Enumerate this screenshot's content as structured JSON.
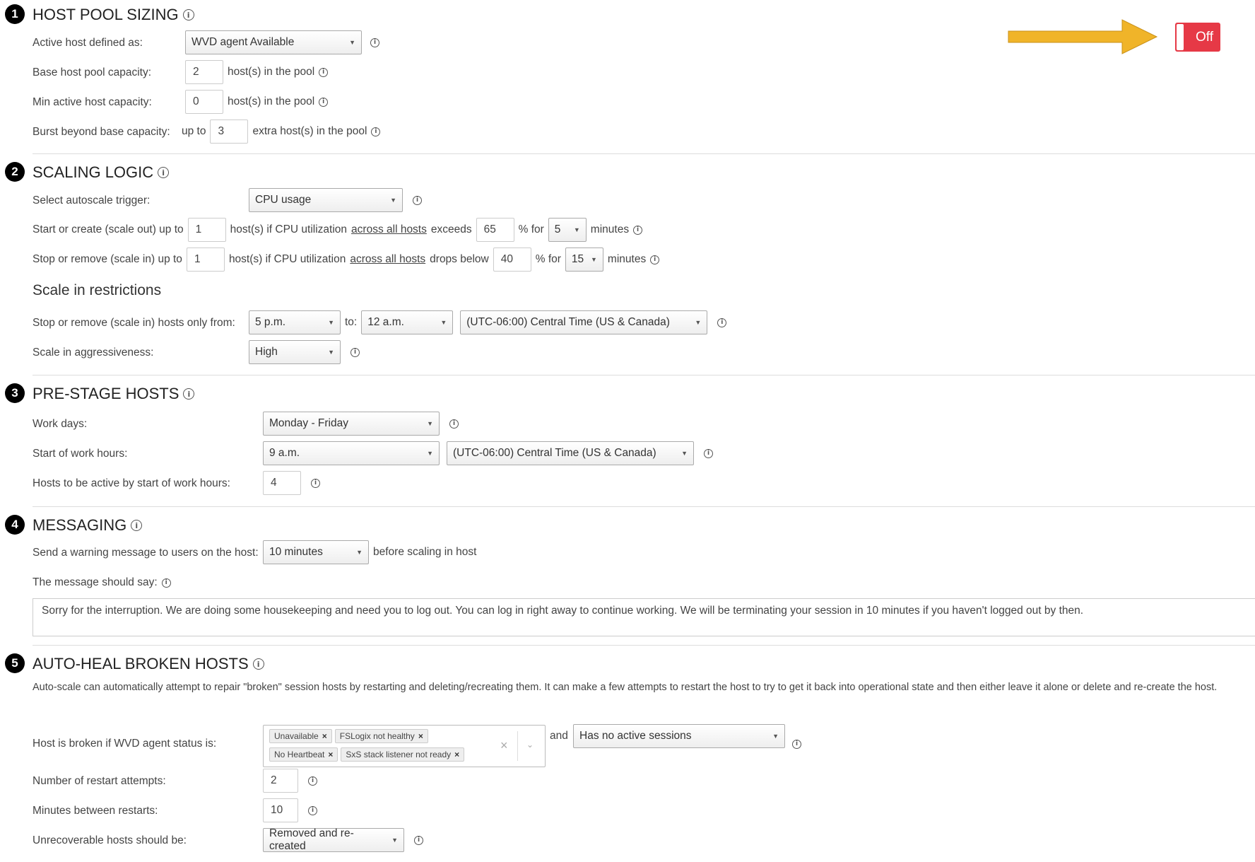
{
  "sections": {
    "s1": {
      "num": "1",
      "title": "HOST POOL SIZING"
    },
    "s2": {
      "num": "2",
      "title": "SCALING LOGIC"
    },
    "s3": {
      "num": "3",
      "title": "PRE-STAGE HOSTS"
    },
    "s4": {
      "num": "4",
      "title": "MESSAGING"
    },
    "s5": {
      "num": "5",
      "title": "AUTO-HEAL BROKEN HOSTS"
    }
  },
  "toggle": {
    "label": "Off"
  },
  "sizing": {
    "active_label": "Active host defined as:",
    "active_value": "WVD agent Available",
    "base_label": "Base host pool capacity:",
    "base_value": "2",
    "base_suffix": "host(s) in the pool",
    "min_label": "Min active host capacity:",
    "min_value": "0",
    "min_suffix": "host(s) in the pool",
    "burst_label": "Burst beyond base capacity:",
    "burst_prefix": "up to",
    "burst_value": "3",
    "burst_suffix": "extra host(s) in the pool"
  },
  "scaling": {
    "trigger_label": "Select autoscale trigger:",
    "trigger_value": "CPU usage",
    "out_label": "Start or create (scale out) up to",
    "out_hosts": "1",
    "out_text1": "host(s) if CPU utilization",
    "out_link": "across all hosts",
    "out_text2": "exceeds",
    "out_pct": "65",
    "out_pct_for": "% for",
    "out_minutes": "5",
    "out_minutes_label": "minutes",
    "in_label": "Stop or remove (scale in) up to",
    "in_hosts": "1",
    "in_text1": "host(s) if CPU utilization",
    "in_link": "across all hosts",
    "in_text2": "drops below",
    "in_pct": "40",
    "in_pct_for": "% for",
    "in_minutes": "15",
    "in_minutes_label": "minutes",
    "restrictions_title": "Scale in restrictions",
    "only_from_label": "Stop or remove (scale in) hosts only from:",
    "from_value": "5 p.m.",
    "to_label": "to:",
    "to_value": "12 a.m.",
    "tz_value": "(UTC-06:00) Central Time (US & Canada)",
    "aggr_label": "Scale in aggressiveness:",
    "aggr_value": "High"
  },
  "prestage": {
    "days_label": "Work days:",
    "days_value": "Monday - Friday",
    "start_label": "Start of work hours:",
    "start_value": "9 a.m.",
    "tz_value": "(UTC-06:00) Central Time (US & Canada)",
    "active_label": "Hosts to be active by start of work hours:",
    "active_value": "4"
  },
  "messaging": {
    "warn_label": "Send a warning message to users on the host:",
    "warn_value": "10 minutes",
    "warn_suffix": "before scaling in host",
    "msg_label": "The message should say:",
    "msg_text": "Sorry for the interruption. We are doing some housekeeping and need you to log out. You can log in right away to continue working. We will be terminating your session in 10 minutes if you haven't logged out by then."
  },
  "autoheal": {
    "desc": "Auto-scale can automatically attempt to repair \"broken\" session hosts by restarting and deleting/recreating them. It can make a few attempts to restart the host to try to get it back into operational state and then either leave it alone or delete and re-create the host.",
    "broken_label": "Host is broken if WVD agent status is:",
    "tags": [
      "Unavailable",
      "FSLogix not healthy",
      "No Heartbeat",
      "SxS stack listener not ready"
    ],
    "and_label": "and",
    "sessions_value": "Has no active sessions",
    "restarts_label": "Number of restart attempts:",
    "restarts_value": "2",
    "minutes_label": "Minutes between restarts:",
    "minutes_value": "10",
    "unrecoverable_label": "Unrecoverable hosts should be:",
    "unrecoverable_value": "Removed and re-created"
  },
  "colors": {
    "toggle_off": "#e63946",
    "arrow": "#f0b429"
  }
}
